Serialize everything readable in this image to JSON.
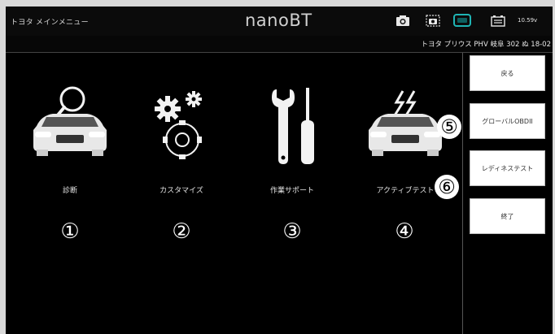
{
  "header": {
    "menu_title": "トヨタ メインメニュー",
    "app_title": "nanoBT",
    "battery_voltage": "10.59v",
    "icons": [
      "camera-icon",
      "screenshot-icon",
      "connection-icon",
      "battery-icon"
    ]
  },
  "vehicle": {
    "info": "トヨタ プリウス PHV 岐阜 302 ぬ 18-02"
  },
  "tiles": [
    {
      "label": "診断",
      "icon": "car-magnifier-icon",
      "number": "①"
    },
    {
      "label": "カスタマイズ",
      "icon": "gears-icon",
      "number": "②"
    },
    {
      "label": "作業サポート",
      "icon": "tools-icon",
      "number": "③"
    },
    {
      "label": "アクティブテスト",
      "icon": "car-lightning-icon",
      "number": "④"
    }
  ],
  "sidebar": {
    "back": "戻る",
    "global_obd": "グローバルOBDII",
    "readiness_test": "レディネステスト",
    "exit": "終了",
    "num_global": "⑤",
    "num_readiness": "⑥"
  },
  "colors": {
    "background": "#000000",
    "text": "#e6e6e6",
    "button_bg": "#ffffff",
    "connection_accent": "#1fb5b5"
  }
}
